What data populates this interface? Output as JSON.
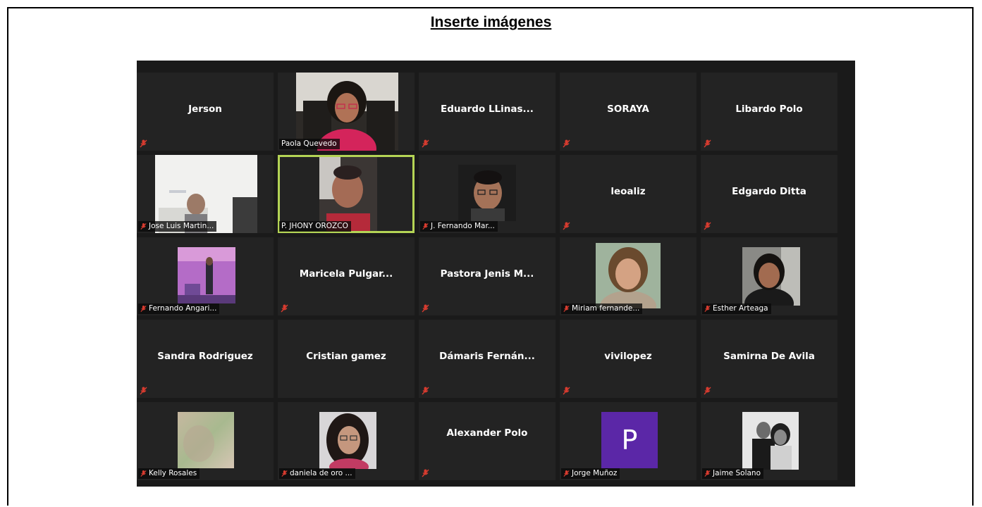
{
  "header": {
    "title": "Inserte imágenes"
  },
  "gallery": {
    "rows": [
      [
        {
          "name": "Jerson",
          "type": "name"
        },
        {
          "name": "Paola Quevedo",
          "type": "video"
        },
        {
          "name": "Eduardo  LLinas...",
          "type": "name"
        },
        {
          "name": "SORAYA",
          "type": "name"
        },
        {
          "name": "Libardo Polo",
          "type": "name"
        }
      ],
      [
        {
          "name": "Jose Luis Martin...",
          "type": "video"
        },
        {
          "name": "P. JHONY OROZCO",
          "type": "video",
          "active": true
        },
        {
          "name": "J. Fernando Mar...",
          "type": "video"
        },
        {
          "name": "leoaliz",
          "type": "name"
        },
        {
          "name": "Edgardo Ditta",
          "type": "name"
        }
      ],
      [
        {
          "name": "Fernando Angari...",
          "type": "video"
        },
        {
          "name": "Maricela  Pulgar...",
          "type": "name"
        },
        {
          "name": "Pastora Jenis M...",
          "type": "name"
        },
        {
          "name": "Miriam fernande...",
          "type": "video"
        },
        {
          "name": "Esther Arteaga",
          "type": "video"
        }
      ],
      [
        {
          "name": "Sandra Rodriguez",
          "type": "name"
        },
        {
          "name": "Cristian gamez",
          "type": "name"
        },
        {
          "name": "Dámaris  Fernán...",
          "type": "name"
        },
        {
          "name": "vivilopez",
          "type": "name"
        },
        {
          "name": "Samirna De Avila",
          "type": "name"
        }
      ],
      [
        {
          "name": "Kelly Rosales",
          "type": "video"
        },
        {
          "name": "daniela de oro ...",
          "type": "video"
        },
        {
          "name": "Alexander Polo",
          "type": "name"
        },
        {
          "name": "Jorge Muñoz",
          "type": "avatar",
          "initial": "P"
        },
        {
          "name": "Jaime Solano",
          "type": "video"
        }
      ]
    ]
  },
  "colors": {
    "active_border": "#b4d455",
    "mute": "#d63b2f",
    "avatar": "#5b27a7"
  },
  "icons": {
    "mute": "muted-mic-icon"
  }
}
